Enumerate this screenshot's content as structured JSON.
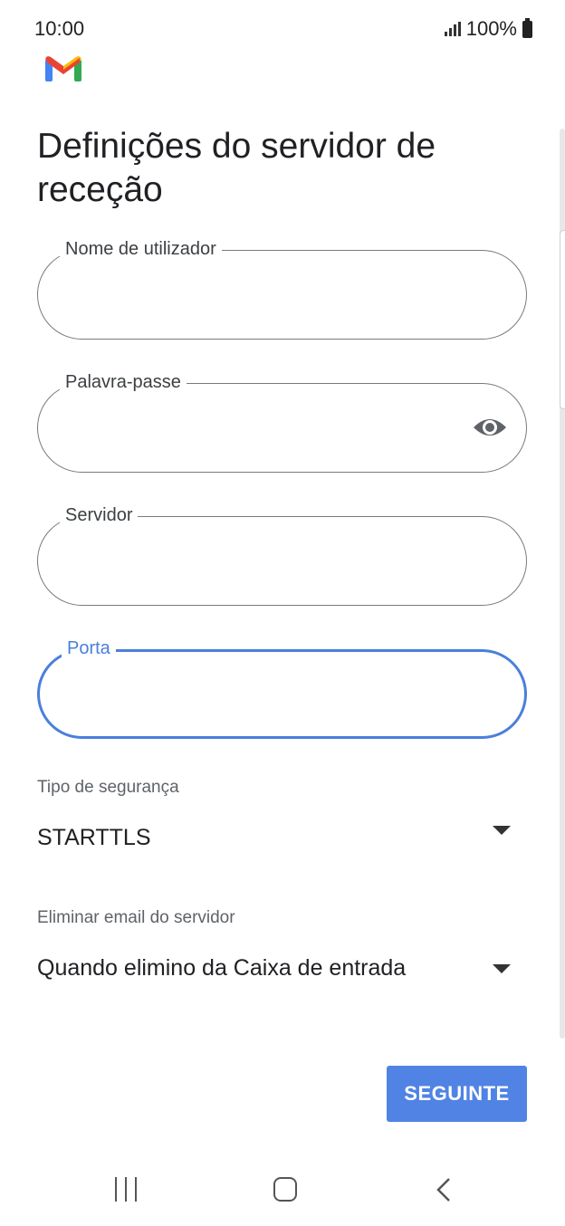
{
  "status_bar": {
    "time": "10:00",
    "battery": "100%"
  },
  "app": {
    "logo_icon": "gmail-logo-icon"
  },
  "page": {
    "title": "Definições do servidor de receção"
  },
  "fields": {
    "username": {
      "label": "Nome de utilizador",
      "value": ""
    },
    "password": {
      "label": "Palavra-passe",
      "value": "",
      "icon": "eye-icon"
    },
    "server": {
      "label": "Servidor",
      "value": ""
    },
    "port": {
      "label": "Porta",
      "value": ""
    }
  },
  "security_type": {
    "label": "Tipo de segurança",
    "value": "STARTTLS"
  },
  "delete_from_server": {
    "label": "Eliminar email do servidor",
    "value": "Quando elimino da Caixa de entrada"
  },
  "actions": {
    "next_label": "SEGUINTE"
  },
  "colors": {
    "accent": "#4a7fdc",
    "button": "#5083e4"
  }
}
